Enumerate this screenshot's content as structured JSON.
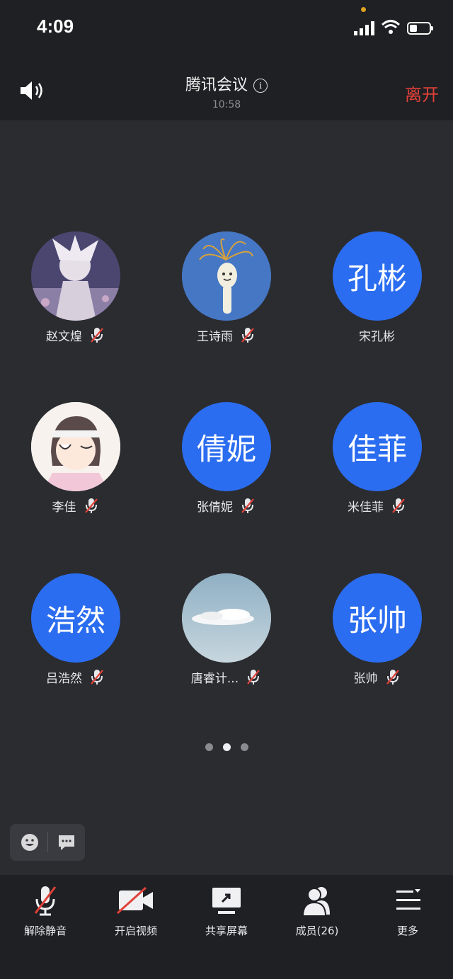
{
  "status_bar": {
    "time": "4:09"
  },
  "header": {
    "title": "腾讯会议",
    "duration": "10:58",
    "leave_label": "离开"
  },
  "participants": [
    {
      "name": "赵文煌",
      "avatar_type": "photo",
      "avatar_text": "",
      "muted": true
    },
    {
      "name": "王诗雨",
      "avatar_type": "photo",
      "avatar_text": "",
      "muted": true
    },
    {
      "name": "宋孔彬",
      "avatar_type": "text",
      "avatar_text": "孔彬",
      "muted": false
    },
    {
      "name": "李佳",
      "avatar_type": "photo",
      "avatar_text": "",
      "muted": true
    },
    {
      "name": "张倩妮",
      "avatar_type": "text",
      "avatar_text": "倩妮",
      "muted": true
    },
    {
      "name": "米佳菲",
      "avatar_type": "text",
      "avatar_text": "佳菲",
      "muted": true
    },
    {
      "name": "吕浩然",
      "avatar_type": "text",
      "avatar_text": "浩然",
      "muted": true
    },
    {
      "name": "唐睿计...",
      "avatar_type": "photo",
      "avatar_text": "",
      "muted": true
    },
    {
      "name": "张帅",
      "avatar_type": "text",
      "avatar_text": "张帅",
      "muted": true
    }
  ],
  "pagination": {
    "pages": 3,
    "current": 2
  },
  "toolbar": {
    "unmute": "解除静音",
    "start_video": "开启视频",
    "share_screen": "共享屏幕",
    "members": "成员(26)",
    "more": "更多"
  },
  "colors": {
    "accent": "#2b6df0",
    "leave": "#e0413a",
    "background": "#2b2c30"
  }
}
